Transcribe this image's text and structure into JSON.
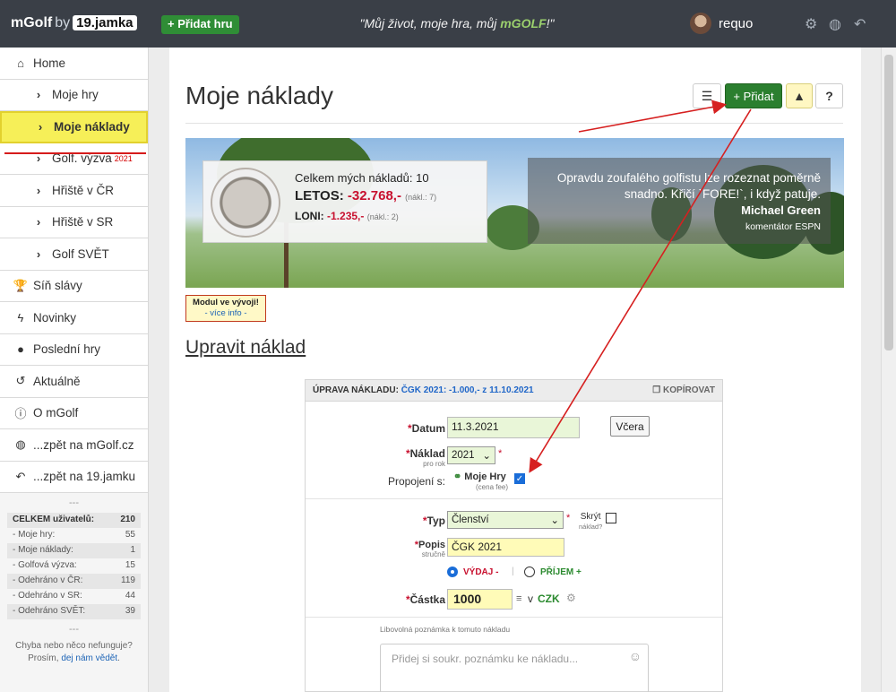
{
  "topbar": {
    "brand_main": "mGolf",
    "brand_by": "by",
    "brand_logo": "19.jamka",
    "add_game": "+ Přidat hru",
    "motto_pre": "\"Můj život, moje hra, můj ",
    "motto_brand": "mGOLF",
    "motto_post": "!\"",
    "user": "requo",
    "icons": [
      "gear-icon",
      "globe-icon",
      "back-icon"
    ]
  },
  "sidebar": {
    "items": [
      {
        "label": "Home",
        "icon": "home-icon"
      },
      {
        "label": "Moje hry",
        "icon": "chevron-right-icon"
      },
      {
        "label": "Moje náklady",
        "icon": "chevron-right-icon"
      },
      {
        "label": "Golf. výzva",
        "icon": "chevron-right-icon",
        "badge": "2021"
      },
      {
        "label": "Hřiště v ČR",
        "icon": "chevron-right-icon"
      },
      {
        "label": "Hřiště v SR",
        "icon": "chevron-right-icon"
      },
      {
        "label": "Golf SVĚT",
        "icon": "chevron-right-icon"
      },
      {
        "label": "Síň slávy",
        "icon": "trophy-icon"
      },
      {
        "label": "Novinky",
        "icon": "bolt-icon"
      },
      {
        "label": "Poslední hry",
        "icon": "golf-ball-icon"
      },
      {
        "label": "Aktuálně",
        "icon": "history-icon"
      },
      {
        "label": "O mGolf",
        "icon": "info-icon"
      },
      {
        "label": "...zpět na mGolf.cz",
        "icon": "globe-icon"
      },
      {
        "label": "...zpět na 19.jamku",
        "icon": "reply-icon"
      }
    ],
    "dash1": "---",
    "stats": [
      {
        "label": "CELKEM uživatelů:",
        "value": "210"
      },
      {
        "label": "- Moje hry:",
        "value": "55"
      },
      {
        "label": "- Moje náklady:",
        "value": "1"
      },
      {
        "label": "- Golfová výzva:",
        "value": "15"
      },
      {
        "label": "- Odehráno v ČR:",
        "value": "119"
      },
      {
        "label": "- Odehráno v SR:",
        "value": "44"
      },
      {
        "label": "- Odehráno SVĚT:",
        "value": "39"
      }
    ],
    "dash2": "---",
    "bug_line1": "Chyba nebo něco nefunguje?",
    "bug_line2_pre": "Prosím, ",
    "bug_link": "dej nám vědět",
    "bug_line2_post": "."
  },
  "main": {
    "title": "Moje náklady",
    "toolbar": {
      "list": "☰",
      "add": "+ Přidat",
      "chart": "▲",
      "help": "?"
    },
    "summary": {
      "count_label": "Celkem mých nákladů: 10",
      "this_year_label": "LETOS:",
      "this_year_value": "-32.768,-",
      "this_year_note": "(nákl.: 7)",
      "last_year_label": "LONI:",
      "last_year_value": "-1.235,-",
      "last_year_note": "(nákl.: 2)"
    },
    "quote": {
      "text": "Opravdu zoufalého golfistu lze rozeznat poměrně snadno. Křičí `FORE!`, i když patuje.",
      "author": "Michael Green",
      "role": "komentátor ESPN"
    },
    "module_note_title": "Modul ve vývoji!",
    "module_note_link": "- více info -",
    "edit_heading": "Upravit náklad",
    "form": {
      "header_label": "ÚPRAVA NÁKLADU:",
      "header_value": "ČGK 2021: -1.000,- z 11.10.2021",
      "copy": "KOPÍROVAT",
      "date_label": "Datum",
      "date_value": "11.3.2021",
      "yesterday": "Včera",
      "cost_label": "Náklad",
      "cost_sub": "pro rok",
      "year_value": "2021",
      "link_label": "Propojení s:",
      "link_target": "Moje Hry",
      "link_sub": "(cena fee)",
      "type_label": "Typ",
      "type_value": "Členství",
      "hide_label": "Skrýt",
      "hide_sub": "náklad?",
      "desc_label": "Popis",
      "desc_sub": "stručně",
      "desc_value": "ČGK 2021",
      "expense_label": "VÝDAJ -",
      "income_label": "PŘÍJEM +",
      "amount_label": "Částka",
      "amount_value": "1000",
      "currency_prefix": "v",
      "currency": "CZK",
      "note_label": "Libovolná poznámka k tomuto nákladu",
      "note_placeholder": "Přidej si soukr. poznámku ke nákladu..."
    }
  },
  "colors": {
    "topbar": "#3a3f47",
    "accent_green": "#2b7f2f",
    "highlight": "#f6ef58",
    "red": "#c8102e",
    "link": "#1d64b6",
    "annotation_arrow": "#d62020"
  }
}
